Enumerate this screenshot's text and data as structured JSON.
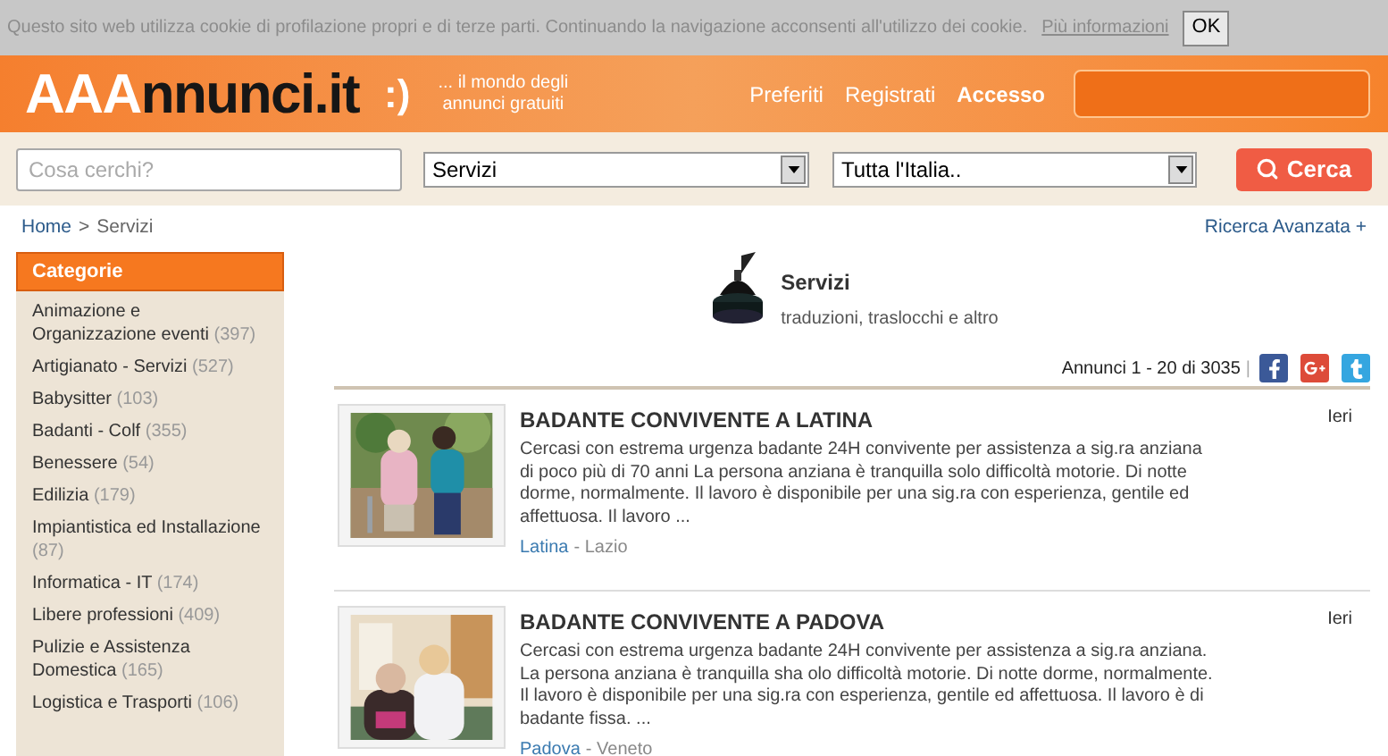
{
  "cookie_bar": {
    "message": "Questo sito web utilizza cookie di profilazione propri e di terze parti. Continuando la navigazione acconsenti all'utilizzo dei cookie.",
    "link": "Più informazioni",
    "button": "OK"
  },
  "header": {
    "logo": {
      "part1": "AAA",
      "part2": "nnunci.it",
      "smiley": ":)"
    },
    "tagline": "... il mondo degli annunci gratuiti",
    "nav": [
      {
        "label": "Preferiti",
        "bold": false
      },
      {
        "label": "Registrati",
        "bold": false
      },
      {
        "label": "Accesso",
        "bold": true
      }
    ]
  },
  "search": {
    "placeholder": "Cosa cerchi?",
    "category": "Servizi",
    "location": "Tutta l'Italia..",
    "button": "Cerca"
  },
  "breadcrumb": [
    {
      "label": "Home",
      "link": true
    },
    {
      "label": ">",
      "link": false
    },
    {
      "label": "Servizi",
      "link": false
    }
  ],
  "advanced_search": "Ricerca Avanzata +",
  "sidebar": {
    "title": "Categorie",
    "items": [
      {
        "name": "Animazione e Organizzazione eventi",
        "count": "(397)"
      },
      {
        "name": "Artigianato - Servizi",
        "count": "(527)"
      },
      {
        "name": "Babysitter",
        "count": "(103)"
      },
      {
        "name": "Badanti - Colf",
        "count": "(355)"
      },
      {
        "name": "Benessere",
        "count": "(54)"
      },
      {
        "name": "Edilizia",
        "count": "(179)"
      },
      {
        "name": "Impiantistica ed Installazione",
        "count": "(87)"
      },
      {
        "name": "Informatica - IT",
        "count": "(174)"
      },
      {
        "name": "Libere professioni",
        "count": "(409)"
      },
      {
        "name": "Pulizie e Assistenza Domestica",
        "count": "(165)"
      },
      {
        "name": "Logistica e Trasporti",
        "count": "(106)"
      }
    ]
  },
  "category_header": {
    "title": "Servizi",
    "subtitle": "traduzioni, traslocchi e altro"
  },
  "results": {
    "count": "Annunci 1 - 20 di 3035",
    "separator": "|"
  },
  "listings": [
    {
      "title": "BADANTE CONVIVENTE A LATINA",
      "date": "Ieri",
      "description": "Cercasi con estrema urgenza badante 24H convivente per assistenza a sig.ra anziana di poco più di 70 anni La persona anziana è tranquilla solo difficoltà motorie. Di notte dorme, normalmente. Il lavoro è disponibile per una sig.ra con esperienza, gentile ed affettuosa. Il lavoro ...",
      "city": "Latina",
      "region": "- Lazio"
    },
    {
      "title": "BADANTE CONVIVENTE A PADOVA",
      "date": "Ieri",
      "description": "Cercasi con estrema urgenza badante 24H convivente per assistenza a sig.ra anziana. La persona anziana è tranquilla sha olo difficoltà motorie. Di notte dorme, normalmente. Il lavoro è disponibile per una sig.ra con esperienza, gentile ed affettuosa. Il lavoro è di badante fissa. ...",
      "city": "Padova",
      "region": "- Veneto"
    }
  ]
}
